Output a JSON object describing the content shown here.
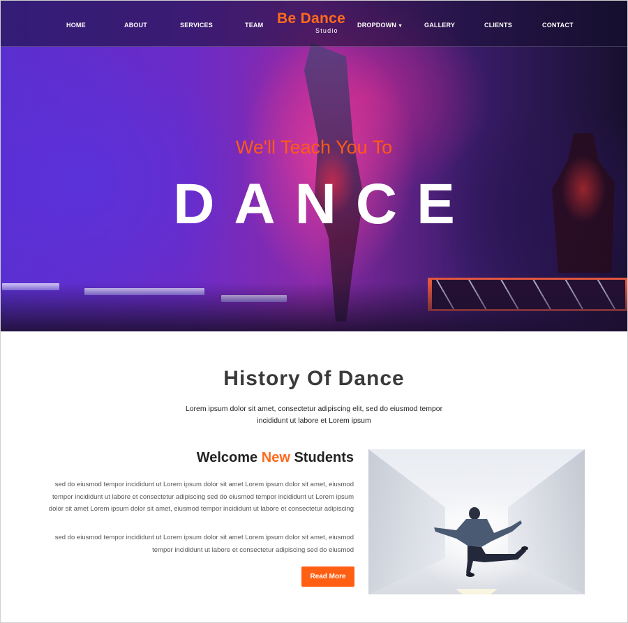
{
  "nav": {
    "items": [
      "HOME",
      "ABOUT",
      "SERVICES",
      "TEAM",
      "DROPDOWN",
      "GALLERY",
      "CLIENTS",
      "CONTACT"
    ],
    "dropdown_icon": "chevron-down-icon"
  },
  "logo": {
    "title": "Be Dance",
    "subtitle": "Studio"
  },
  "hero": {
    "tagline": "We'll Teach You To",
    "headline": "DANCE"
  },
  "history": {
    "title": "History Of Dance",
    "intro": "Lorem ipsum dolor sit amet, consectetur adipiscing elit, sed do eiusmod tempor incididunt ut labore et Lorem ipsum"
  },
  "welcome": {
    "heading_pre": "Welcome",
    "heading_accent": "New",
    "heading_post": "Students",
    "paragraph_1": "sed do eiusmod tempor incididunt ut Lorem ipsum dolor sit amet Lorem ipsum dolor sit amet, eiusmod tempor incididunt ut labore et consectetur adipiscing sed do eiusmod tempor incididunt ut Lorem ipsum dolor sit amet Lorem ipsum dolor sit amet, eiusmod tempor incididunt ut labore et consectetur adipiscing",
    "paragraph_2": "sed do eiusmod tempor incididunt ut Lorem ipsum dolor sit amet Lorem ipsum dolor sit amet, eiusmod tempor incididunt ut labore et consectetur adipiscing sed do eiusmod",
    "read_more_label": "Read More"
  },
  "colors": {
    "accent": "#ff6a1c",
    "button": "#ff5f13",
    "heading": "#3a3a3a"
  }
}
